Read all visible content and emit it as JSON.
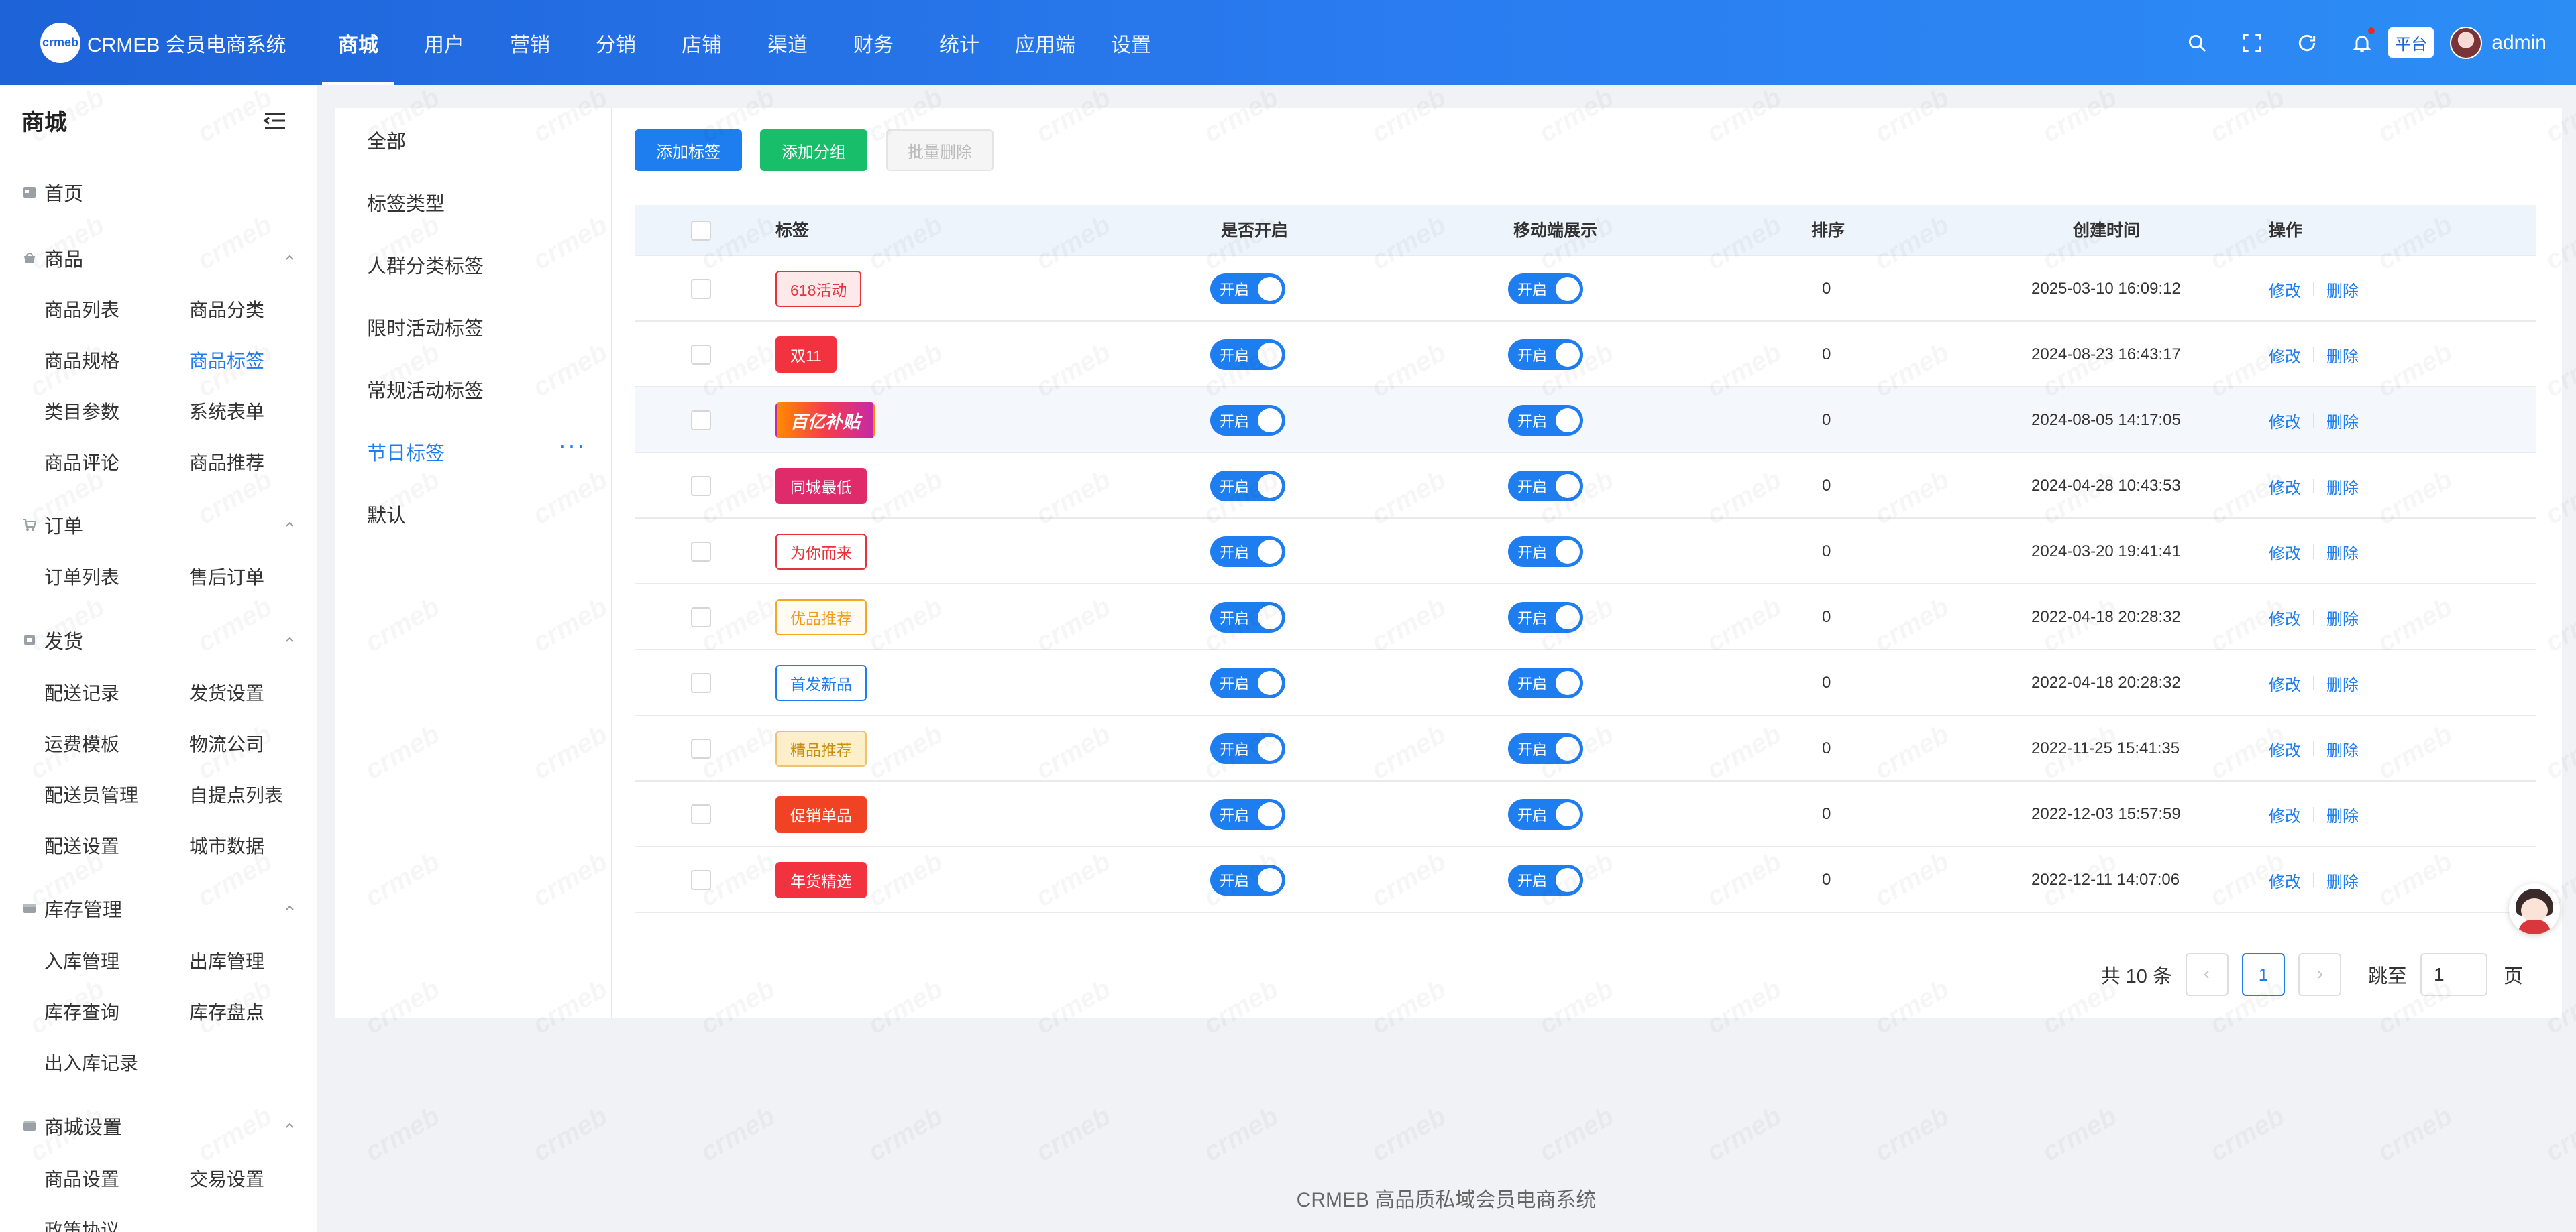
{
  "header": {
    "logo_text": "crmeb",
    "brand": "CRMEB 会员电商系统",
    "nav": [
      {
        "label": "商城",
        "active": true
      },
      {
        "label": "用户"
      },
      {
        "label": "营销"
      },
      {
        "label": "分销"
      },
      {
        "label": "店铺"
      },
      {
        "label": "渠道"
      },
      {
        "label": "财务"
      },
      {
        "label": "统计"
      },
      {
        "label": "应用端"
      },
      {
        "label": "设置"
      }
    ],
    "platform_badge": "平台",
    "username": "admin",
    "icons": [
      "search-icon",
      "fullscreen-icon",
      "refresh-icon",
      "bell-icon"
    ]
  },
  "sidebar": {
    "title": "商城",
    "home": "首页",
    "groups": [
      {
        "label": "商品",
        "icon": "goods-icon",
        "items": [
          "商品列表",
          "商品分类",
          "商品规格",
          "商品标签",
          "类目参数",
          "系统表单",
          "商品评论",
          "商品推荐"
        ],
        "active": "商品标签"
      },
      {
        "label": "订单",
        "icon": "cart-icon",
        "items": [
          "订单列表",
          "售后订单"
        ]
      },
      {
        "label": "发货",
        "icon": "delivery-icon",
        "items": [
          "配送记录",
          "发货设置",
          "运费模板",
          "物流公司",
          "配送员管理",
          "自提点列表",
          "配送设置",
          "城市数据"
        ]
      },
      {
        "label": "库存管理",
        "icon": "inventory-icon",
        "items": [
          "入库管理",
          "出库管理",
          "库存查询",
          "库存盘点",
          "出入库记录"
        ]
      },
      {
        "label": "商城设置",
        "icon": "store-settings-icon",
        "items": [
          "商品设置",
          "交易设置",
          "政策协议"
        ]
      }
    ]
  },
  "subnav": {
    "items": [
      "全部",
      "标签类型",
      "人群分类标签",
      "限时活动标签",
      "常规活动标签",
      "节日标签",
      "默认"
    ],
    "active_index": 5,
    "more": "···"
  },
  "toolbar": {
    "add_tag": "添加标签",
    "add_group": "添加分组",
    "batch_delete": "批量删除"
  },
  "table": {
    "columns": [
      "标签",
      "是否开启",
      "移动端展示",
      "排序",
      "创建时间",
      "操作"
    ],
    "switch_label": "开启",
    "edit_label": "修改",
    "delete_label": "删除",
    "rows": [
      {
        "tag": "618活动",
        "style": "pink-outline",
        "sort": "0",
        "created": "2025-03-10 16:09:12"
      },
      {
        "tag": "双11",
        "style": "red-solid",
        "sort": "0",
        "created": "2024-08-23 16:43:17"
      },
      {
        "tag": "百亿补贴",
        "style": "gradient-image",
        "sort": "0",
        "created": "2024-08-05 14:17:05"
      },
      {
        "tag": "同城最低",
        "style": "magenta-solid",
        "sort": "0",
        "created": "2024-04-28 10:43:53"
      },
      {
        "tag": "为你而来",
        "style": "red-outline",
        "sort": "0",
        "created": "2024-03-20 19:41:41"
      },
      {
        "tag": "优品推荐",
        "style": "orange-outline",
        "sort": "0",
        "created": "2022-04-18 20:28:32"
      },
      {
        "tag": "首发新品",
        "style": "blue-outline",
        "sort": "0",
        "created": "2022-04-18 20:28:32"
      },
      {
        "tag": "精品推荐",
        "style": "yellow-fill",
        "sort": "0",
        "created": "2022-11-25 15:41:35"
      },
      {
        "tag": "促销单品",
        "style": "orange-red-solid",
        "sort": "0",
        "created": "2022-12-03 15:57:59"
      },
      {
        "tag": "年货精选",
        "style": "red-solid",
        "sort": "0",
        "created": "2022-12-11 14:07:06"
      }
    ]
  },
  "pagination": {
    "total": "共 10 条",
    "current": "1",
    "jump_label": "跳至",
    "jump_value": "1",
    "unit": "页"
  },
  "footer": "CRMEB 高品质私域会员电商系统",
  "watermark": "crmeb",
  "colors": {
    "primary": "#1e7ef0",
    "success": "#19be6b",
    "header_gradient_start": "#1e63d8",
    "header_gradient_end": "#2c8df5"
  }
}
